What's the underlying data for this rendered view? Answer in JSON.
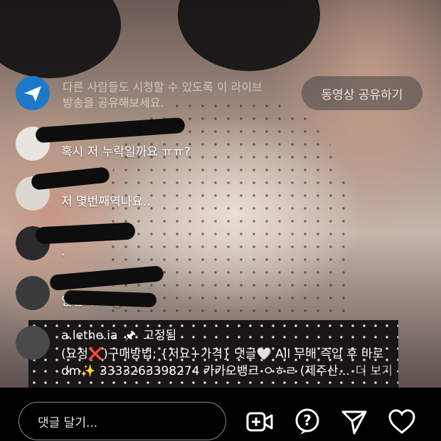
{
  "share_banner": {
    "text_line1": "다른 사람들도 시청할 수 있도록 이 라이브",
    "text_line2": "방송을 공유해보세요.",
    "button_label": "동영상 공유하기"
  },
  "comments": [
    {
      "username": "",
      "text": "혹시 저 누락일까요 ㅠㅠ?"
    },
    {
      "username": "",
      "text": "저 몇번째역나요.."
    },
    {
      "username": "",
      "text": "."
    },
    {
      "username": "",
      "text": "인집어 ...🙂"
    }
  ],
  "pinned": {
    "username": "a.lethe.ia",
    "pin_label": "고정됨",
    "line1": "(요청❌)구매방법; {저요+가격} 댓글🤍 All 무배 즉입 후 바로",
    "line2": "dm✨ 3333263398274 카카오뱅크 ㅇㅎㄹ (제주산...",
    "more_label": "더 보기"
  },
  "bottom_bar": {
    "comment_placeholder": "댓글 달기...",
    "icons": [
      "video-add-icon",
      "question-icon",
      "send-icon",
      "heart-icon"
    ]
  }
}
